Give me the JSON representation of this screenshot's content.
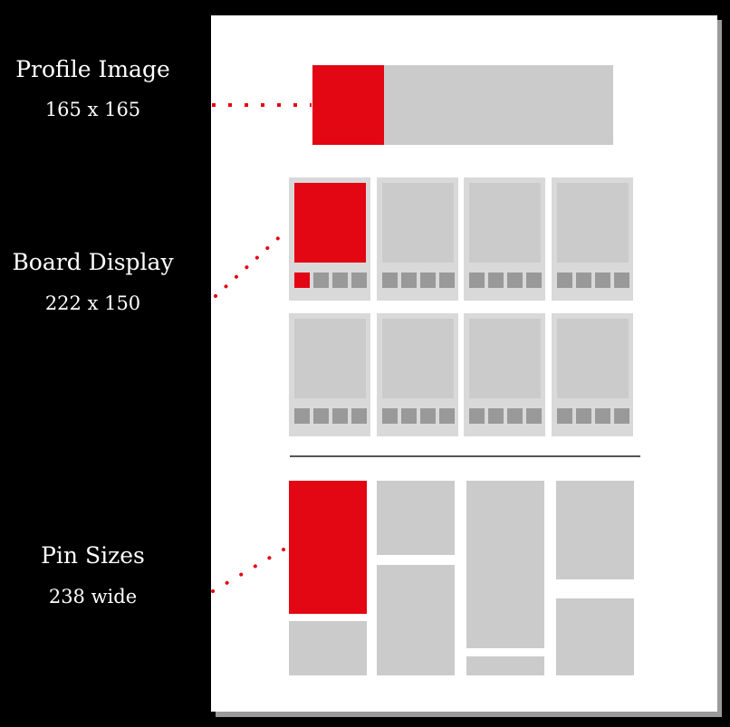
{
  "accent_color": "#e30613",
  "annotations": [
    {
      "id": "profile",
      "title": "Profile Image",
      "size": "165 x 165"
    },
    {
      "id": "board",
      "title": "Board Display",
      "size": "222 x 150"
    },
    {
      "id": "pin",
      "title": "Pin Sizes",
      "size": "238 wide"
    }
  ],
  "layout_mockup": {
    "profile_section": {
      "highlighted": "profile-image"
    },
    "boards": {
      "rows": 2,
      "columns": 4,
      "thumbnails_per_board": 4,
      "highlighted_board": 1
    },
    "pins": {
      "columns": 4,
      "highlighted_pin": 1
    }
  }
}
